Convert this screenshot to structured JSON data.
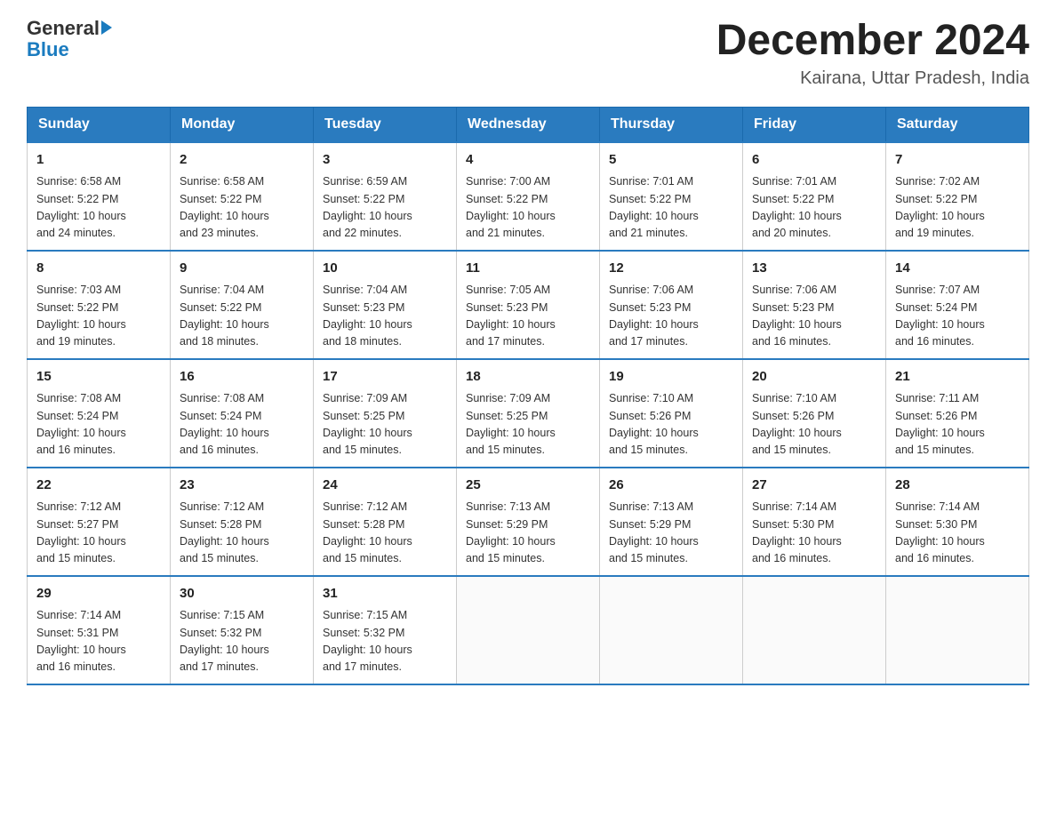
{
  "header": {
    "logo_general": "General",
    "logo_blue": "Blue",
    "month_title": "December 2024",
    "location": "Kairana, Uttar Pradesh, India"
  },
  "days_of_week": [
    "Sunday",
    "Monday",
    "Tuesday",
    "Wednesday",
    "Thursday",
    "Friday",
    "Saturday"
  ],
  "weeks": [
    [
      {
        "day": "1",
        "sunrise": "6:58 AM",
        "sunset": "5:22 PM",
        "daylight": "10 hours and 24 minutes."
      },
      {
        "day": "2",
        "sunrise": "6:58 AM",
        "sunset": "5:22 PM",
        "daylight": "10 hours and 23 minutes."
      },
      {
        "day": "3",
        "sunrise": "6:59 AM",
        "sunset": "5:22 PM",
        "daylight": "10 hours and 22 minutes."
      },
      {
        "day": "4",
        "sunrise": "7:00 AM",
        "sunset": "5:22 PM",
        "daylight": "10 hours and 21 minutes."
      },
      {
        "day": "5",
        "sunrise": "7:01 AM",
        "sunset": "5:22 PM",
        "daylight": "10 hours and 21 minutes."
      },
      {
        "day": "6",
        "sunrise": "7:01 AM",
        "sunset": "5:22 PM",
        "daylight": "10 hours and 20 minutes."
      },
      {
        "day": "7",
        "sunrise": "7:02 AM",
        "sunset": "5:22 PM",
        "daylight": "10 hours and 19 minutes."
      }
    ],
    [
      {
        "day": "8",
        "sunrise": "7:03 AM",
        "sunset": "5:22 PM",
        "daylight": "10 hours and 19 minutes."
      },
      {
        "day": "9",
        "sunrise": "7:04 AM",
        "sunset": "5:22 PM",
        "daylight": "10 hours and 18 minutes."
      },
      {
        "day": "10",
        "sunrise": "7:04 AM",
        "sunset": "5:23 PM",
        "daylight": "10 hours and 18 minutes."
      },
      {
        "day": "11",
        "sunrise": "7:05 AM",
        "sunset": "5:23 PM",
        "daylight": "10 hours and 17 minutes."
      },
      {
        "day": "12",
        "sunrise": "7:06 AM",
        "sunset": "5:23 PM",
        "daylight": "10 hours and 17 minutes."
      },
      {
        "day": "13",
        "sunrise": "7:06 AM",
        "sunset": "5:23 PM",
        "daylight": "10 hours and 16 minutes."
      },
      {
        "day": "14",
        "sunrise": "7:07 AM",
        "sunset": "5:24 PM",
        "daylight": "10 hours and 16 minutes."
      }
    ],
    [
      {
        "day": "15",
        "sunrise": "7:08 AM",
        "sunset": "5:24 PM",
        "daylight": "10 hours and 16 minutes."
      },
      {
        "day": "16",
        "sunrise": "7:08 AM",
        "sunset": "5:24 PM",
        "daylight": "10 hours and 16 minutes."
      },
      {
        "day": "17",
        "sunrise": "7:09 AM",
        "sunset": "5:25 PM",
        "daylight": "10 hours and 15 minutes."
      },
      {
        "day": "18",
        "sunrise": "7:09 AM",
        "sunset": "5:25 PM",
        "daylight": "10 hours and 15 minutes."
      },
      {
        "day": "19",
        "sunrise": "7:10 AM",
        "sunset": "5:26 PM",
        "daylight": "10 hours and 15 minutes."
      },
      {
        "day": "20",
        "sunrise": "7:10 AM",
        "sunset": "5:26 PM",
        "daylight": "10 hours and 15 minutes."
      },
      {
        "day": "21",
        "sunrise": "7:11 AM",
        "sunset": "5:26 PM",
        "daylight": "10 hours and 15 minutes."
      }
    ],
    [
      {
        "day": "22",
        "sunrise": "7:12 AM",
        "sunset": "5:27 PM",
        "daylight": "10 hours and 15 minutes."
      },
      {
        "day": "23",
        "sunrise": "7:12 AM",
        "sunset": "5:28 PM",
        "daylight": "10 hours and 15 minutes."
      },
      {
        "day": "24",
        "sunrise": "7:12 AM",
        "sunset": "5:28 PM",
        "daylight": "10 hours and 15 minutes."
      },
      {
        "day": "25",
        "sunrise": "7:13 AM",
        "sunset": "5:29 PM",
        "daylight": "10 hours and 15 minutes."
      },
      {
        "day": "26",
        "sunrise": "7:13 AM",
        "sunset": "5:29 PM",
        "daylight": "10 hours and 15 minutes."
      },
      {
        "day": "27",
        "sunrise": "7:14 AM",
        "sunset": "5:30 PM",
        "daylight": "10 hours and 16 minutes."
      },
      {
        "day": "28",
        "sunrise": "7:14 AM",
        "sunset": "5:30 PM",
        "daylight": "10 hours and 16 minutes."
      }
    ],
    [
      {
        "day": "29",
        "sunrise": "7:14 AM",
        "sunset": "5:31 PM",
        "daylight": "10 hours and 16 minutes."
      },
      {
        "day": "30",
        "sunrise": "7:15 AM",
        "sunset": "5:32 PM",
        "daylight": "10 hours and 17 minutes."
      },
      {
        "day": "31",
        "sunrise": "7:15 AM",
        "sunset": "5:32 PM",
        "daylight": "10 hours and 17 minutes."
      },
      null,
      null,
      null,
      null
    ]
  ],
  "labels": {
    "sunrise": "Sunrise:",
    "sunset": "Sunset:",
    "daylight": "Daylight:"
  }
}
